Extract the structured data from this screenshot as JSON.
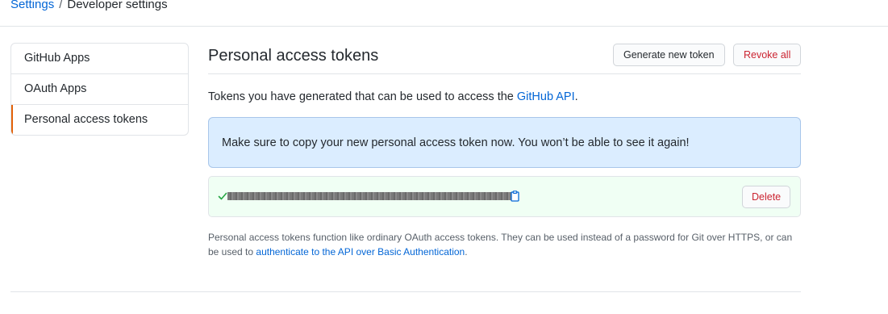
{
  "breadcrumb": {
    "parent": "Settings",
    "separator": "/",
    "current": "Developer settings"
  },
  "sidebar": {
    "items": [
      {
        "label": "GitHub Apps",
        "active": false
      },
      {
        "label": "OAuth Apps",
        "active": false
      },
      {
        "label": "Personal access tokens",
        "active": true
      }
    ]
  },
  "header": {
    "title": "Personal access tokens",
    "generate_label": "Generate new token",
    "revoke_label": "Revoke all"
  },
  "description": {
    "text": "Tokens you have generated that can be used to access the ",
    "link": "GitHub API",
    "suffix": "."
  },
  "flash": {
    "message": "Make sure to copy your new personal access token now. You won’t be able to see it again!"
  },
  "token": {
    "delete_label": "Delete",
    "status_icon": "check-icon",
    "copy_icon": "clipboard-icon"
  },
  "note": {
    "text": "Personal access tokens function like ordinary OAuth access tokens. They can be used instead of a password for Git over HTTPS, or can be used to ",
    "link": "authenticate to the API over Basic Authentication",
    "suffix": "."
  },
  "colors": {
    "link": "#0366d6",
    "danger": "#cb2431",
    "flash_bg": "#dbedff",
    "token_bg": "#f0fff4",
    "active_marker": "#e36209"
  }
}
